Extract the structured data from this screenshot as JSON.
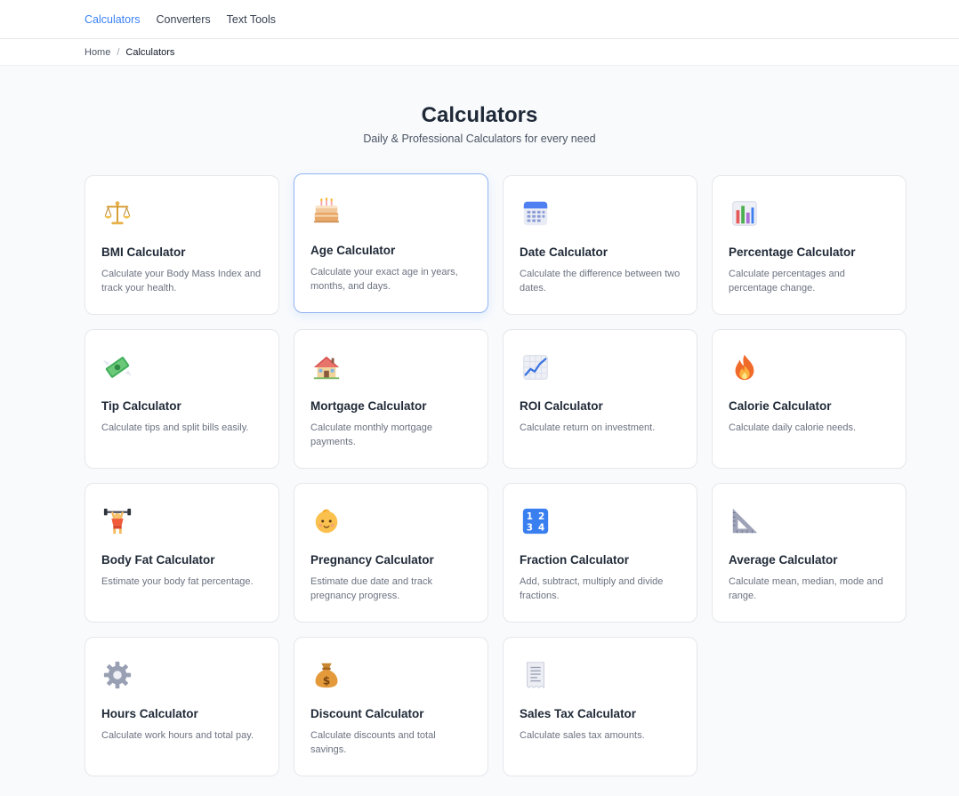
{
  "nav": {
    "items": [
      {
        "label": "Calculators",
        "active": true
      },
      {
        "label": "Converters",
        "active": false
      },
      {
        "label": "Text Tools",
        "active": false
      }
    ]
  },
  "breadcrumb": {
    "home": "Home",
    "separator": "/",
    "current": "Calculators"
  },
  "hero": {
    "title": "Calculators",
    "subtitle": "Daily & Professional Calculators for every need"
  },
  "accent_color": "#3b82f6",
  "cards": [
    {
      "title": "BMI Calculator",
      "description": "Calculate your Body Mass Index and track your health.",
      "icon": "balance-scale-icon"
    },
    {
      "title": "Age Calculator",
      "description": "Calculate your exact age in years, months, and days.",
      "icon": "birthday-cake-icon"
    },
    {
      "title": "Date Calculator",
      "description": "Calculate the difference between two dates.",
      "icon": "calendar-icon"
    },
    {
      "title": "Percentage Calculator",
      "description": "Calculate percentages and percentage change.",
      "icon": "bar-chart-icon"
    },
    {
      "title": "Tip Calculator",
      "description": "Calculate tips and split bills easily.",
      "icon": "money-wings-icon"
    },
    {
      "title": "Mortgage Calculator",
      "description": "Calculate monthly mortgage payments.",
      "icon": "house-icon"
    },
    {
      "title": "ROI Calculator",
      "description": "Calculate return on investment.",
      "icon": "trend-up-chart-icon"
    },
    {
      "title": "Calorie Calculator",
      "description": "Calculate daily calorie needs.",
      "icon": "fire-icon"
    },
    {
      "title": "Body Fat Calculator",
      "description": "Estimate your body fat percentage.",
      "icon": "weightlifter-icon"
    },
    {
      "title": "Pregnancy Calculator",
      "description": "Estimate due date and track pregnancy progress.",
      "icon": "baby-icon"
    },
    {
      "title": "Fraction Calculator",
      "description": "Add, subtract, multiply and divide fractions.",
      "icon": "numbers-1234-icon"
    },
    {
      "title": "Average Calculator",
      "description": "Calculate mean, median, mode and range.",
      "icon": "triangle-ruler-icon"
    },
    {
      "title": "Hours Calculator",
      "description": "Calculate work hours and total pay.",
      "icon": "gear-icon"
    },
    {
      "title": "Discount Calculator",
      "description": "Calculate discounts and total savings.",
      "icon": "money-bag-icon"
    },
    {
      "title": "Sales Tax Calculator",
      "description": "Calculate sales tax amounts.",
      "icon": "receipt-icon"
    }
  ]
}
